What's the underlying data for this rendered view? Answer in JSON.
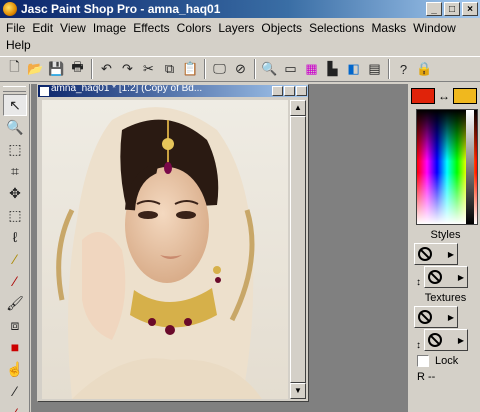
{
  "window": {
    "title": "Jasc Paint Shop Pro - amna_haq01"
  },
  "menu": {
    "row1": [
      "File",
      "Edit",
      "View",
      "Image",
      "Effects",
      "Colors",
      "Layers",
      "Objects",
      "Selections",
      "Masks",
      "Window"
    ],
    "row2": [
      "Help"
    ]
  },
  "document": {
    "title": "amna_haq01 * [1:2] (Copy of Bd..."
  },
  "colors": {
    "foreground": "#e0230a",
    "background": "#f0b81e"
  },
  "palette": {
    "styles_label": "Styles",
    "textures_label": "Textures",
    "lock_label": "Lock",
    "rgb_label": "R   --"
  }
}
